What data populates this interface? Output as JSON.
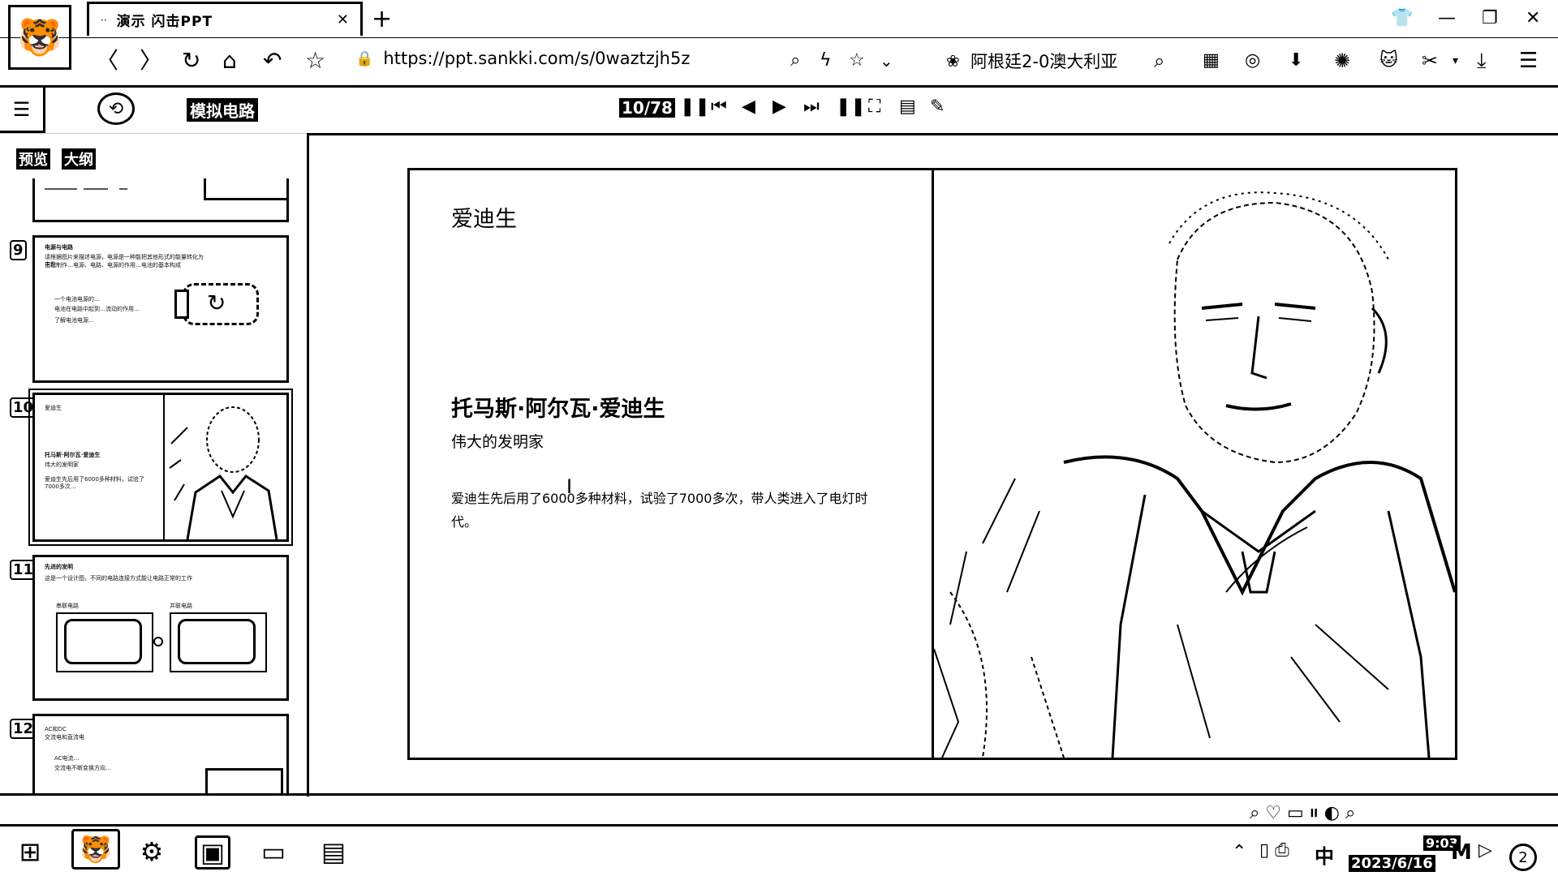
{
  "browser": {
    "tab_title": "演示  闪击PPT",
    "tab_favicon": "··",
    "tab_close": "✕",
    "new_tab": "+",
    "url": "https://ppt.sankki.com/s/0waztzjh5z",
    "news_ticker": "阿根廷2-0澳大利亚"
  },
  "presentation": {
    "deck_name": "模拟电路",
    "pager": "10/78",
    "panel_tabs": [
      "预览",
      "大纲"
    ],
    "thumbnails": [
      {
        "num": "9",
        "title": "电源与电路",
        "lines": [
          "请根据图片来描述电源，电源是一种能把其他形式的能量转化为电能",
          "正在制作…电源、电路、电源的作用…电池的基本构成"
        ],
        "side_lines": [
          "一个电池电源的…",
          "电池在电路中起到…流动的作用…",
          "了解电池电源…"
        ]
      },
      {
        "num": "10",
        "title": "爱迪生",
        "name": "托马斯·阿尔瓦·爱迪生",
        "sub": "伟大的发明家",
        "body": "爱迪生先后用了6000多种材料，试验了7000多次…"
      },
      {
        "num": "11",
        "title": "先进的发明",
        "lines": [
          "这是一个设计图，不同的电路连接方式能让电路正常的工作"
        ],
        "left_label": "串联电路",
        "right_label": "并联电路"
      },
      {
        "num": "12",
        "title": "AC和DC",
        "sub": "交流电和直流电",
        "lines": [
          "AC电流…",
          "交流电不断变换方向…"
        ]
      }
    ]
  },
  "slide": {
    "title": "爱迪生",
    "name": "托马斯·阿尔瓦·爱迪生",
    "subtitle": "伟大的发明家",
    "body": "爱迪生先后用了6000多种材料，试验了7000多次，带人类进入了电灯时代。"
  },
  "taskbar": {
    "time": "9:03",
    "date": "2023/6/16",
    "ime": "中",
    "notifications": "2"
  },
  "icons": {
    "app": "tiger-logo-icon",
    "start": "windows-start-icon",
    "settings": "gear-icon"
  }
}
